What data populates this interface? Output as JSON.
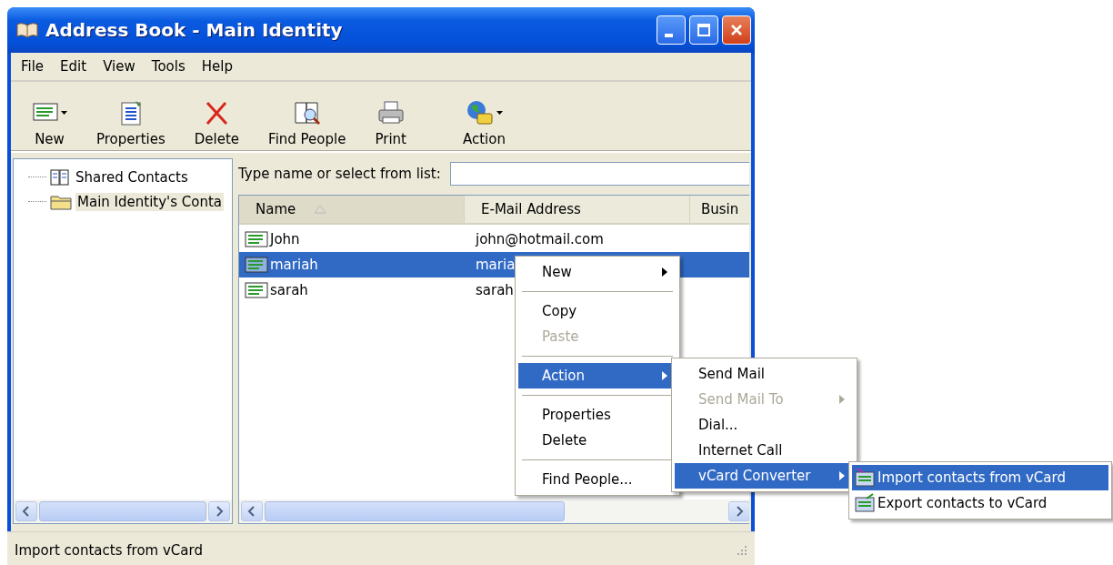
{
  "window": {
    "title": "Address Book - Main Identity"
  },
  "menu_bar": [
    "File",
    "Edit",
    "View",
    "Tools",
    "Help"
  ],
  "toolbar": [
    {
      "label": "New",
      "dropdown": true
    },
    {
      "label": "Properties",
      "dropdown": false
    },
    {
      "label": "Delete",
      "dropdown": false
    },
    {
      "label": "Find People",
      "dropdown": false
    },
    {
      "label": "Print",
      "dropdown": false
    },
    {
      "label": "Action",
      "dropdown": true
    }
  ],
  "tree": [
    {
      "label": "Shared Contacts",
      "selected": false
    },
    {
      "label": "Main Identity's Conta",
      "selected": true
    }
  ],
  "search": {
    "label": "Type name or select from list:"
  },
  "table": {
    "columns": [
      {
        "label": "Name",
        "sorted": true
      },
      {
        "label": "E-Mail Address",
        "sorted": false
      },
      {
        "label": "Busin",
        "sorted": false
      }
    ],
    "rows": [
      {
        "name": "John",
        "email": "john@hotmail.com",
        "selected": false
      },
      {
        "name": "mariah",
        "email": "maria",
        "selected": true
      },
      {
        "name": "sarah",
        "email": "sarah",
        "selected": false
      }
    ]
  },
  "context_menu": [
    {
      "kind": "item",
      "label": "New",
      "submenu": true,
      "disabled": false,
      "selected": false
    },
    {
      "kind": "separator"
    },
    {
      "kind": "item",
      "label": "Copy",
      "submenu": false,
      "disabled": false,
      "selected": false
    },
    {
      "kind": "item",
      "label": "Paste",
      "submenu": false,
      "disabled": true,
      "selected": false
    },
    {
      "kind": "separator"
    },
    {
      "kind": "item",
      "label": "Action",
      "submenu": true,
      "disabled": false,
      "selected": true
    },
    {
      "kind": "separator"
    },
    {
      "kind": "item",
      "label": "Properties",
      "submenu": false,
      "disabled": false,
      "selected": false
    },
    {
      "kind": "item",
      "label": "Delete",
      "submenu": false,
      "disabled": false,
      "selected": false
    },
    {
      "kind": "separator"
    },
    {
      "kind": "item",
      "label": "Find People...",
      "submenu": false,
      "disabled": false,
      "selected": false
    }
  ],
  "action_submenu": [
    {
      "kind": "item",
      "label": "Send Mail",
      "submenu": false,
      "disabled": false,
      "selected": false
    },
    {
      "kind": "item",
      "label": "Send Mail To",
      "submenu": true,
      "disabled": true,
      "selected": false
    },
    {
      "kind": "item",
      "label": "Dial...",
      "submenu": false,
      "disabled": false,
      "selected": false
    },
    {
      "kind": "item",
      "label": "Internet Call",
      "submenu": false,
      "disabled": false,
      "selected": false
    },
    {
      "kind": "item",
      "label": "vCard Converter",
      "submenu": true,
      "disabled": false,
      "selected": true
    }
  ],
  "vcard_submenu": [
    {
      "kind": "item",
      "label": "Import contacts from vCard",
      "selected": true
    },
    {
      "kind": "item",
      "label": "Export contacts to vCard",
      "selected": false
    }
  ],
  "status_bar": "Import contacts from vCard"
}
